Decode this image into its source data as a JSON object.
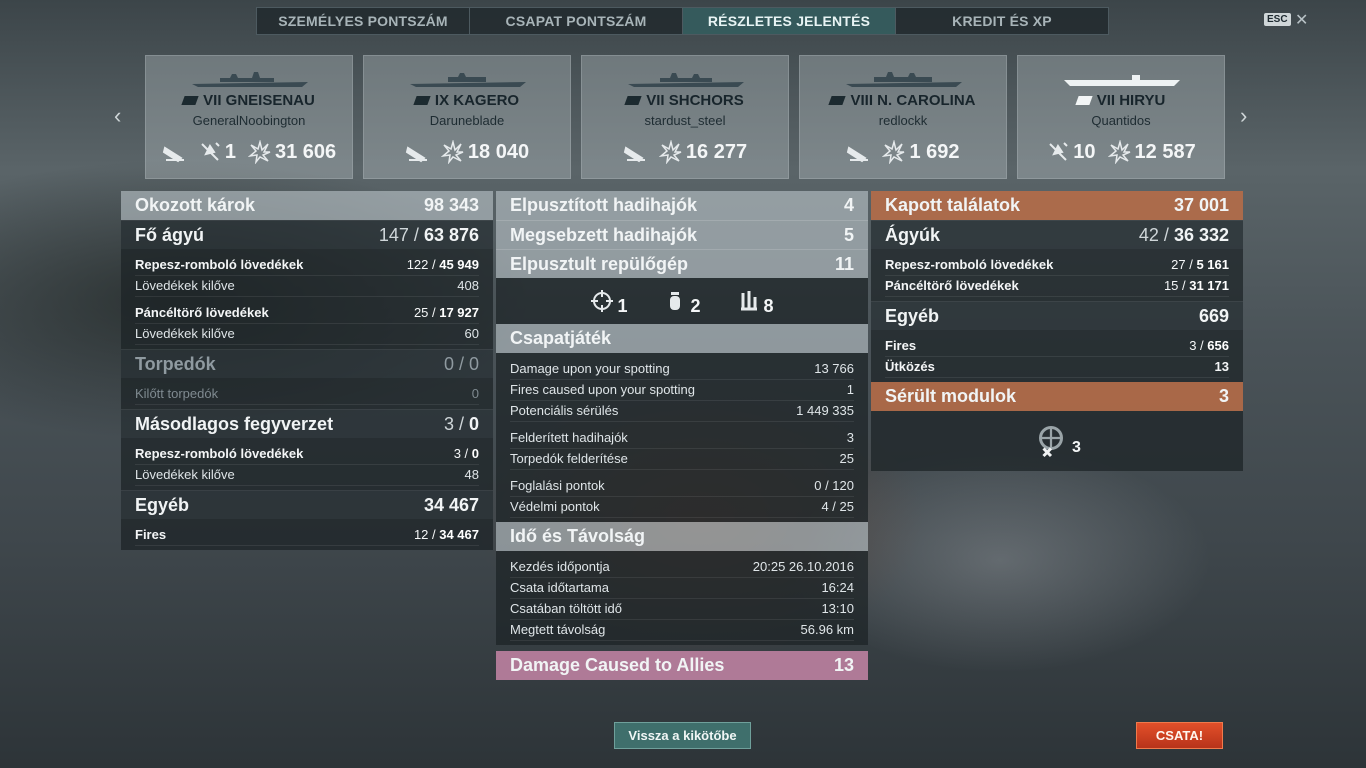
{
  "tabs": [
    "SZEMÉLYES PONTSZÁM",
    "CSAPAT PONTSZÁM",
    "RÉSZLETES JELENTÉS",
    "KREDIT ÉS XP"
  ],
  "esc_label": "ESC",
  "close_glyph": "✕",
  "arrows": {
    "left": "‹",
    "right": "›"
  },
  "cards": [
    {
      "ship": "VII GNEISENAU",
      "player": "GeneralNoobington",
      "stats": [
        "",
        "1",
        "31 606"
      ]
    },
    {
      "ship": "IX KAGERO",
      "player": "Daruneblade",
      "stats": [
        "",
        "18 040"
      ]
    },
    {
      "ship": "VII SHCHORS",
      "player": "stardust_steel",
      "stats": [
        "",
        "16 277"
      ]
    },
    {
      "ship": "VIII N. CAROLINA",
      "player": "redlockk",
      "stats": [
        "",
        "1 692"
      ]
    },
    {
      "ship": "VII HIRYU",
      "player": "Quantidos",
      "stats": [
        "10",
        "12 587"
      ]
    }
  ],
  "left": {
    "damage": {
      "label": "Okozott károk",
      "value": "98 343"
    },
    "main": {
      "label": "Fő ágyú",
      "value_a": "147 / ",
      "value_b": "63 876"
    },
    "he": {
      "label": "Repesz-romboló lövedékek",
      "value_a": "122 / ",
      "value_b": "45 949"
    },
    "he_fired": {
      "label": "Lövedékek kilőve",
      "value": "408"
    },
    "ap": {
      "label": "Páncéltörő lövedékek",
      "value_a": "25 / ",
      "value_b": "17 927"
    },
    "ap_fired": {
      "label": "Lövedékek kilőve",
      "value": "60"
    },
    "torp": {
      "label": "Torpedók",
      "value": "0 / 0"
    },
    "torp_fired": {
      "label": "Kilőtt torpedók",
      "value": "0"
    },
    "secondary": {
      "label": "Másodlagos fegyverzet",
      "value_a": "3 / ",
      "value_b": "0"
    },
    "sec_he": {
      "label": "Repesz-romboló lövedékek",
      "value_a": "3 / ",
      "value_b": "0"
    },
    "sec_fired": {
      "label": "Lövedékek kilőve",
      "value": "48"
    },
    "other": {
      "label": "Egyéb",
      "value": "34 467"
    },
    "fires": {
      "label": "Fires",
      "value_a": "12 / ",
      "value_b": "34 467"
    }
  },
  "mid": {
    "destroyed": {
      "label": "Elpusztított hadihajók",
      "value": "4"
    },
    "damaged": {
      "label": "Megsebzett hadihajók",
      "value": "5"
    },
    "planes": {
      "label": "Elpusztult repülőgép",
      "value": "11"
    },
    "icon_counts": {
      "spot": "1",
      "bomb": "2",
      "rocket": "8"
    },
    "team": {
      "label": "Csapatjáték"
    },
    "team_rows": [
      {
        "label": "Damage upon your spotting",
        "value": "13 766"
      },
      {
        "label": "Fires caused upon your spotting",
        "value": "1"
      },
      {
        "label": "Potenciális sérülés",
        "value": "1 449 335"
      },
      {
        "label": "Felderített hadihajók",
        "value": "3"
      },
      {
        "label": "Torpedók felderítése",
        "value": "25"
      },
      {
        "label": "Foglalási pontok",
        "value": "0 / 120"
      },
      {
        "label": "Védelmi pontok",
        "value": "4 / 25"
      }
    ],
    "time": {
      "label": "Idő és Távolság"
    },
    "time_rows": [
      {
        "label": "Kezdés időpontja",
        "value": "20:25  26.10.2016"
      },
      {
        "label": "Csata időtartama",
        "value": "16:24"
      },
      {
        "label": "Csatában töltött idő",
        "value": "13:10"
      },
      {
        "label": "Megtett távolság",
        "value": "56.96 km"
      }
    ],
    "allies": {
      "label": "Damage Caused to Allies",
      "value": "13"
    }
  },
  "right": {
    "received": {
      "label": "Kapott találatok",
      "value": "37 001"
    },
    "guns": {
      "label": "Ágyúk",
      "value_a": "42 / ",
      "value_b": "36 332"
    },
    "he": {
      "label": "Repesz-romboló lövedékek",
      "value_a": "27 / ",
      "value_b": "5 161"
    },
    "ap": {
      "label": "Páncéltörő lövedékek",
      "value_a": "15 / ",
      "value_b": "31 171"
    },
    "other": {
      "label": "Egyéb",
      "value": "669"
    },
    "fires": {
      "label": "Fires",
      "value_a": "3 / ",
      "value_b": "656"
    },
    "ram": {
      "label": "Ütközés",
      "value": "13"
    },
    "modules": {
      "label": "Sérült modulok",
      "value": "3"
    },
    "module_count": "3"
  },
  "buttons": {
    "back": "Vissza a kikötőbe",
    "battle": "CSATA!"
  }
}
